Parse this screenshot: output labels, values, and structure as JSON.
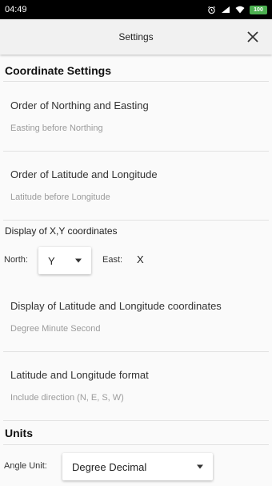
{
  "status_bar": {
    "time": "04:49",
    "battery": "100"
  },
  "app_bar": {
    "title": "Settings"
  },
  "sections": {
    "coordinate": {
      "header": "Coordinate Settings",
      "order_ne": {
        "title": "Order of Northing and Easting",
        "value": "Easting before Northing"
      },
      "order_latlon": {
        "title": "Order of Latitude and Longitude",
        "value": "Latitude before Longitude"
      },
      "xy_display": {
        "label": "Display of X,Y coordinates",
        "north_label": "North:",
        "north_value": "Y",
        "east_label": "East:",
        "east_value": "X"
      },
      "latlon_display": {
        "title": "Display of Latitude and Longitude coordinates",
        "value": "Degree Minute Second"
      },
      "latlon_format": {
        "title": "Latitude and Longitude format",
        "value": "Include direction (N, E, S, W)"
      }
    },
    "units": {
      "header": "Units",
      "angle_label": "Angle Unit:",
      "angle_value": "Degree Decimal"
    }
  }
}
